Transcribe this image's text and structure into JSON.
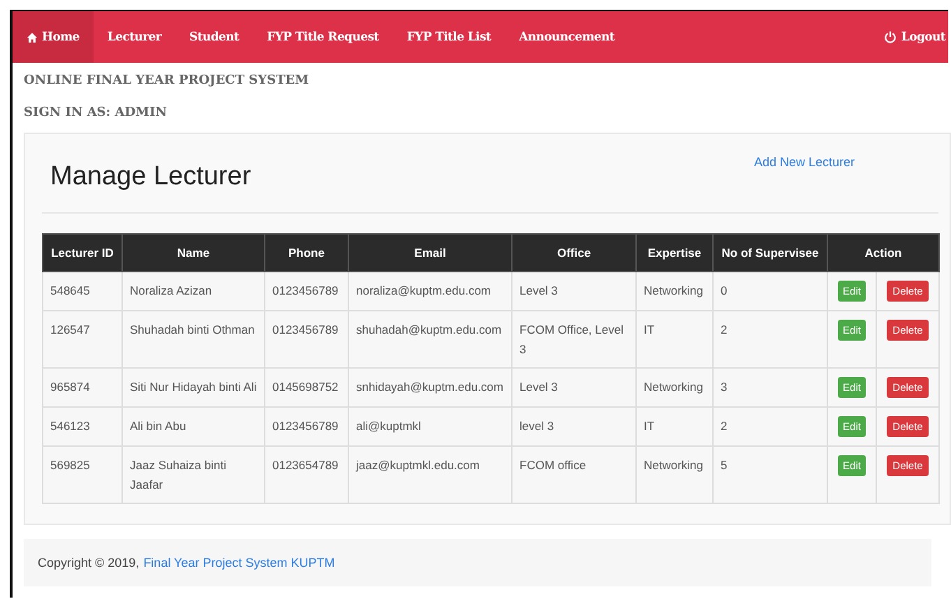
{
  "navbar": {
    "items": [
      {
        "label": "Home",
        "selected": true
      },
      {
        "label": "Lecturer",
        "selected": false
      },
      {
        "label": "Student",
        "selected": false
      },
      {
        "label": "FYP Title Request",
        "selected": false
      },
      {
        "label": "FYP Title List",
        "selected": false
      },
      {
        "label": "Announcement",
        "selected": false
      }
    ],
    "logout": "Logout"
  },
  "header": {
    "system_title": "ONLINE FINAL YEAR PROJECT SYSTEM",
    "signed_in": "SIGN IN AS: ADMIN"
  },
  "panel": {
    "title": "Manage Lecturer",
    "add_link": "Add New Lecturer"
  },
  "table": {
    "columns": [
      "Lecturer ID",
      "Name",
      "Phone",
      "Email",
      "Office",
      "Expertise",
      "No of Supervisee",
      "Action"
    ],
    "rows": [
      {
        "id": "548645",
        "name": "Noraliza Azizan",
        "phone": "0123456789",
        "email": "noraliza@kuptm.edu.com",
        "office": "Level 3",
        "expertise": "Networking",
        "supervisee": "0",
        "edit": "Edit",
        "delete": "Delete"
      },
      {
        "id": "126547",
        "name": "Shuhadah binti Othman",
        "phone": "0123456789",
        "email": "shuhadah@kuptm.edu.com",
        "office": "FCOM Office, Level 3",
        "expertise": "IT",
        "supervisee": "2",
        "edit": "Edit",
        "delete": "Delete"
      },
      {
        "id": "965874",
        "name": "Siti Nur Hidayah binti Ali",
        "phone": "0145698752",
        "email": "snhidayah@kuptm.edu.com",
        "office": "Level 3",
        "expertise": "Networking",
        "supervisee": "3",
        "edit": "Edit",
        "delete": "Delete"
      },
      {
        "id": "546123",
        "name": "Ali bin Abu",
        "phone": "0123456789",
        "email": "ali@kuptmkl",
        "office": "level 3",
        "expertise": "IT",
        "supervisee": "2",
        "edit": "Edit",
        "delete": "Delete"
      },
      {
        "id": "569825",
        "name": "Jaaz Suhaiza binti Jaafar",
        "phone": "0123654789",
        "email": "jaaz@kuptmkl.edu.com",
        "office": "FCOM office",
        "expertise": "Networking",
        "supervisee": "5",
        "edit": "Edit",
        "delete": "Delete"
      }
    ]
  },
  "footer": {
    "copyright": "Copyright © 2019,",
    "link": "Final Year Project System KUPTM"
  }
}
